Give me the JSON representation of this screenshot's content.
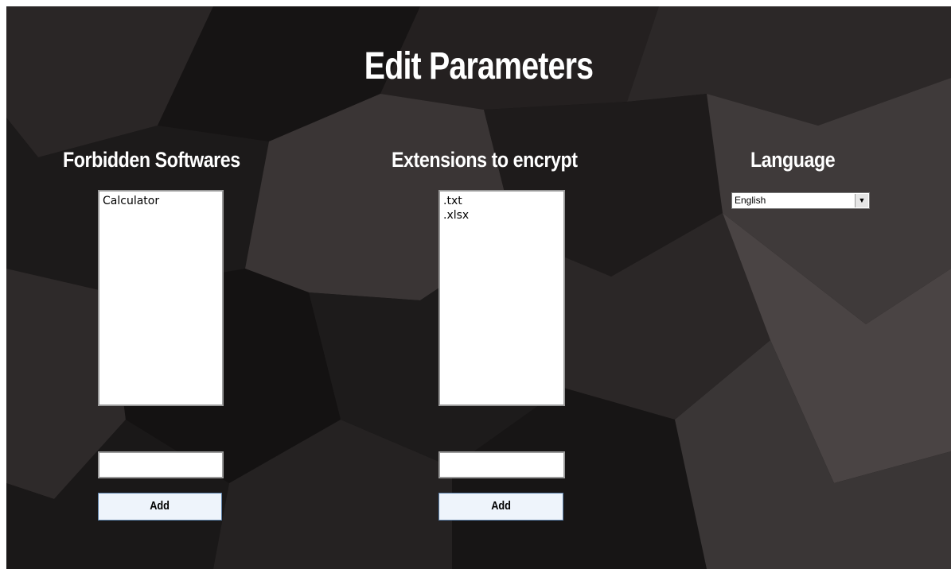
{
  "page": {
    "title": "Edit Parameters"
  },
  "forbidden": {
    "heading": "Forbidden Softwares",
    "items": [
      "Calculator"
    ],
    "input_value": "",
    "add_label": "Add"
  },
  "extensions": {
    "heading": "Extensions to encrypt",
    "items": [
      ".txt",
      ".xlsx"
    ],
    "input_value": "",
    "add_label": "Add"
  },
  "language": {
    "heading": "Language",
    "selected": "English",
    "arrow_icon": "dropdown-arrow-icon"
  }
}
